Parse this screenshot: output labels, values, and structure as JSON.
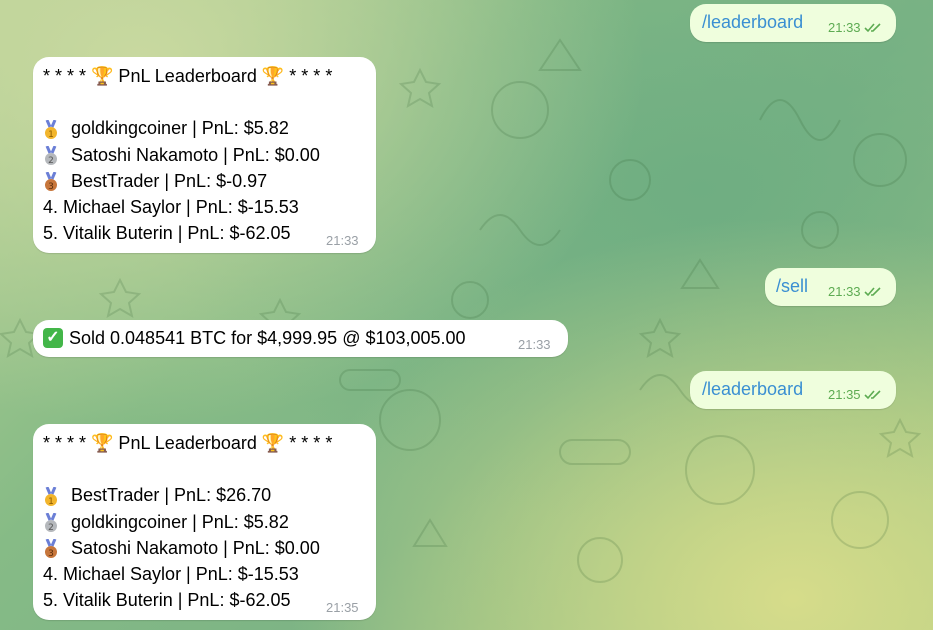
{
  "messages": [
    {
      "id": "m1",
      "text": "/leaderboard",
      "time": "21:33"
    },
    {
      "id": "m2",
      "title": "* * * * 🏆 PnL Leaderboard 🏆 * * * *",
      "medal_rows": [
        "goldkingcoiner | PnL: $5.82",
        "Satoshi Nakamoto | PnL: $0.00",
        "BestTrader | PnL: $-0.97"
      ],
      "rows": [
        "4. Michael Saylor | PnL: $-15.53",
        "5. Vitalik Buterin | PnL: $-62.05"
      ],
      "time": "21:33"
    },
    {
      "id": "m3",
      "text": "/sell",
      "time": "21:33"
    },
    {
      "id": "m4",
      "text": "Sold 0.048541 BTC for $4,999.95 @ $103,005.00",
      "time": "21:33"
    },
    {
      "id": "m5",
      "text": "/leaderboard",
      "time": "21:35"
    },
    {
      "id": "m6",
      "title": "* * * * 🏆 PnL Leaderboard 🏆 * * * *",
      "medal_rows": [
        "BestTrader | PnL: $26.70",
        "goldkingcoiner | PnL: $5.82",
        "Satoshi Nakamoto | PnL: $0.00"
      ],
      "rows": [
        "4. Michael Saylor | PnL: $-15.53",
        "5. Vitalik Buterin | PnL: $-62.05"
      ],
      "time": "21:35"
    }
  ],
  "colors": {
    "outgoing_bg": "#effedd",
    "incoming_bg": "#ffffff",
    "command_text": "#3a8fd2",
    "read_check": "#5dab52",
    "check_bg": "#43b649"
  }
}
